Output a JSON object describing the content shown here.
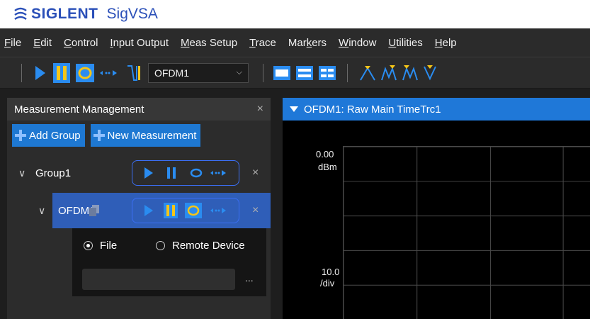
{
  "app": {
    "brand": "SIGLENT",
    "name": "SigVSA"
  },
  "menu": [
    {
      "mnemonic": "F",
      "rest": "ile"
    },
    {
      "mnemonic": "E",
      "rest": "dit"
    },
    {
      "mnemonic": "C",
      "rest": "ontrol"
    },
    {
      "mnemonic": "I",
      "rest": "nput Output"
    },
    {
      "mnemonic": "M",
      "rest": "eas Setup"
    },
    {
      "mnemonic": "T",
      "rest": "race"
    },
    {
      "pre": "Mar",
      "mnemonic": "k",
      "rest": "ers"
    },
    {
      "mnemonic": "W",
      "rest": "indow"
    },
    {
      "mnemonic": "U",
      "rest": "tilities"
    },
    {
      "mnemonic": "H",
      "rest": "elp"
    }
  ],
  "toolbar": {
    "measurement_select": "OFDM1",
    "icons": [
      "play-icon",
      "pause-icon",
      "single-sweep-icon",
      "continue-icon",
      "trigger-icon",
      "layout-single-icon",
      "layout-two-row-icon",
      "layout-quad-icon",
      "marker-peak-icon",
      "marker-next-peak-icon",
      "marker-peak-left-icon",
      "marker-min-icon"
    ]
  },
  "measurement_panel": {
    "title": "Measurement Management",
    "close_label": "×",
    "add_group_label": "Add Group",
    "new_measurement_label": "New Measurement",
    "group": {
      "name": "Group1",
      "close_label": "×"
    },
    "measurement": {
      "name": "OFDM1",
      "close_label": "×"
    },
    "source": {
      "file_label": "File",
      "remote_label": "Remote Device",
      "selected": "File",
      "file_value": "",
      "browse_label": "..."
    }
  },
  "trace_window": {
    "title": "OFDM1: Raw Main TimeTrc1",
    "ref_level": "0.00",
    "ref_unit": "dBm",
    "scale": "10.0",
    "scale_unit": "/div"
  },
  "colors": {
    "accent_blue": "#1e78d2",
    "selected_row": "#2f5eb8",
    "control_outline": "#3b6ff5",
    "play_blue": "#2a8cf0",
    "pause_yellow": "#f5c518",
    "marker_yellow": "#f5c518",
    "brand_blue": "#2a4fb8"
  }
}
